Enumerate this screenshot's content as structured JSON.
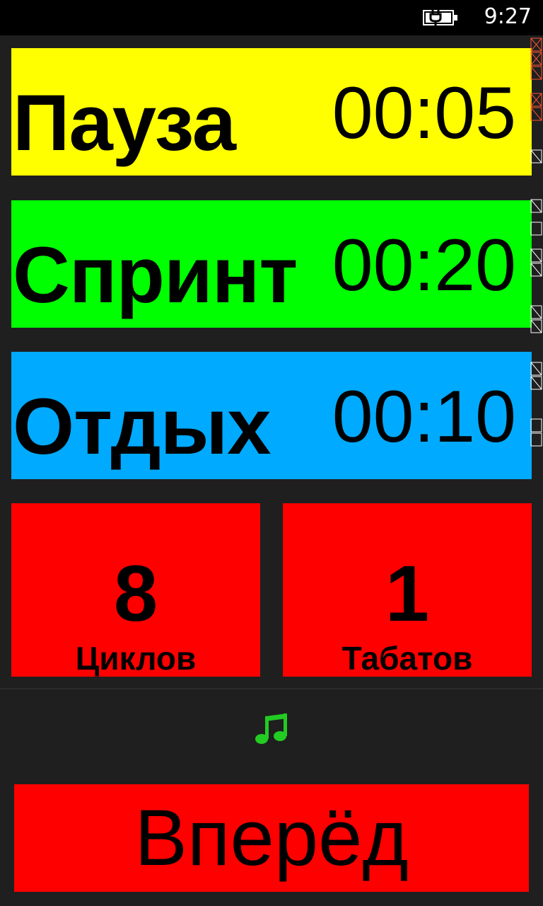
{
  "status_bar": {
    "time": "9:27",
    "battery_icon": "battery-charging-icon"
  },
  "panels": {
    "pause": {
      "label": "Пауза",
      "time": "00:05",
      "color": "#ffff00"
    },
    "sprint": {
      "label": "Спринт",
      "time": "00:20",
      "color": "#00ff00"
    },
    "rest": {
      "label": "Отдых",
      "time": "00:10",
      "color": "#00aaff"
    }
  },
  "counters": {
    "cycles": {
      "value": "8",
      "label": "Циклов"
    },
    "tabatas": {
      "value": "1",
      "label": "Табатов"
    },
    "color": "#ff0000"
  },
  "sound": {
    "icon": "music-note-icon",
    "color": "#22cc22"
  },
  "action": {
    "label": "Вперёд",
    "color": "#ff0000"
  }
}
